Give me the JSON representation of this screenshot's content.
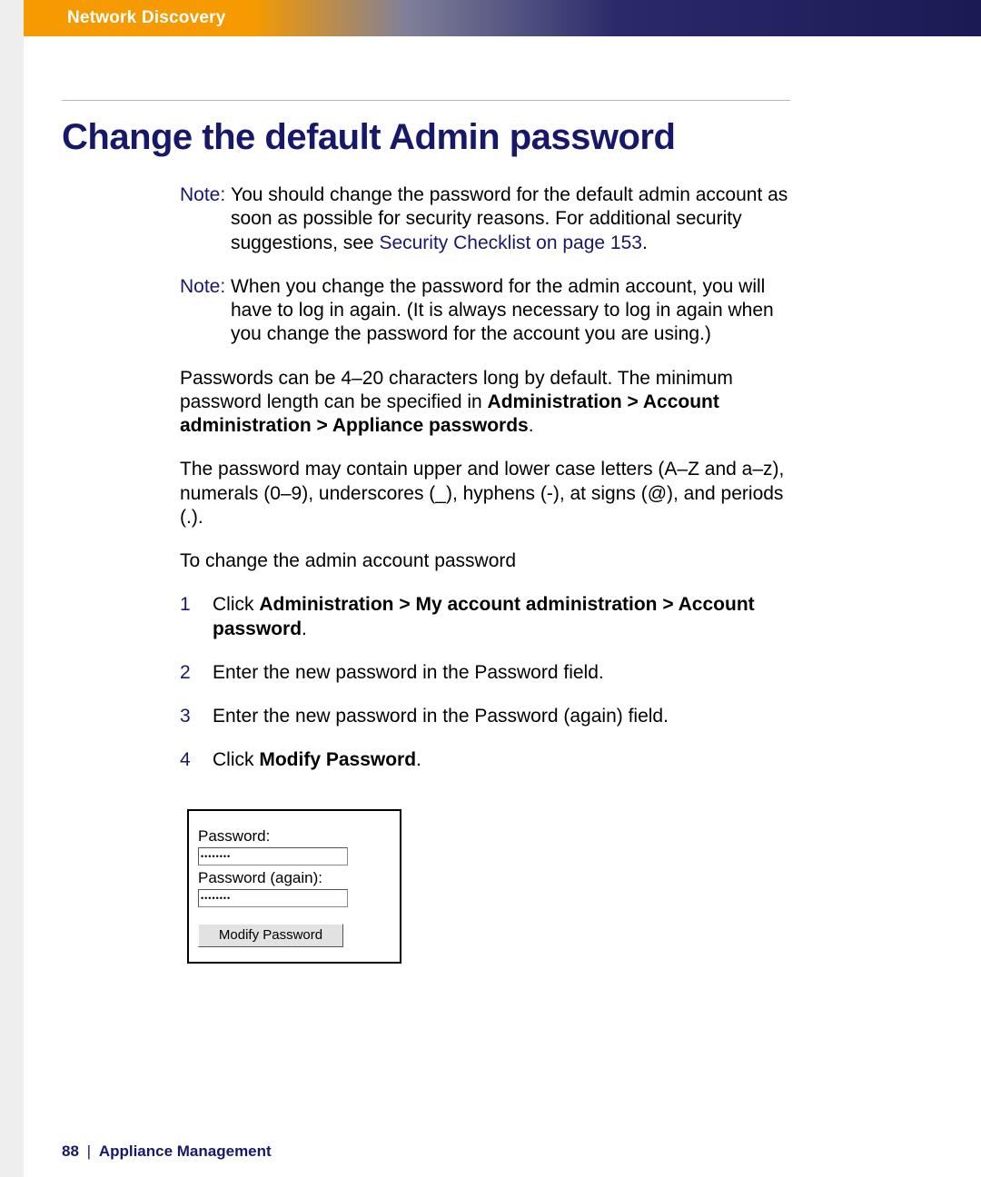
{
  "banner": {
    "title": "Network Discovery"
  },
  "title": "Change the default Admin password",
  "notes": [
    {
      "label": "Note:",
      "text_pre": "You should change the password for the default admin account as soon as possible for security reasons. For additional security suggestions, see ",
      "link": "Security Checklist on page 153",
      "text_post": "."
    },
    {
      "label": "Note:",
      "text_pre": "When you change the password for the admin account, you will have to log in again. (It is always necessary to log in again when you change the password for the account you are using.)",
      "link": "",
      "text_post": ""
    }
  ],
  "paragraphs": {
    "len_pre": "Passwords can be 4–20 characters long by default. The minimum password length can be specified in ",
    "len_bold": "Administration > Account administration > Appliance passwords",
    "len_post": ".",
    "chars": "The password may contain upper and lower case letters (A–Z and a–z), numerals (0–9), underscores (_), hyphens (-), at signs (@), and periods (.).",
    "lead": "To change the admin account password"
  },
  "steps": [
    {
      "num": "1",
      "pre": "Click ",
      "bold": "Administration > My account administration > Account password",
      "post": "."
    },
    {
      "num": "2",
      "pre": "Enter the new password in the Password field.",
      "bold": "",
      "post": ""
    },
    {
      "num": "3",
      "pre": "Enter the new password in the Password (again) field.",
      "bold": "",
      "post": ""
    },
    {
      "num": "4",
      "pre": "Click ",
      "bold": "Modify Password",
      "post": "."
    }
  ],
  "form": {
    "label1": "Password:",
    "label2": "Password (again):",
    "value1": "password",
    "value2": "password",
    "button": "Modify Password"
  },
  "footer": {
    "page": "88",
    "sep": "|",
    "section": "Appliance Management"
  }
}
